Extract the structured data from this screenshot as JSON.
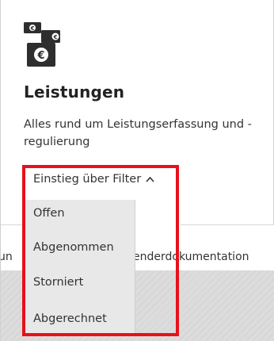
{
  "tile": {
    "icon": "money-stack-icon",
    "icon_color": "#2e2e2e",
    "title": "Leistungen",
    "description": "Alles rund um Leistungserfassung und -regulierung"
  },
  "filter": {
    "trigger_label": "Einstieg über Filter",
    "chevron": "^",
    "options": [
      {
        "label": "Offen"
      },
      {
        "label": "Abgenommen"
      },
      {
        "label": "Storniert"
      },
      {
        "label": "Abgerechnet"
      }
    ]
  },
  "background": {
    "left_fragment": "un",
    "right_fragment": "enderdokumentation"
  },
  "highlight_color": "#e8101a"
}
